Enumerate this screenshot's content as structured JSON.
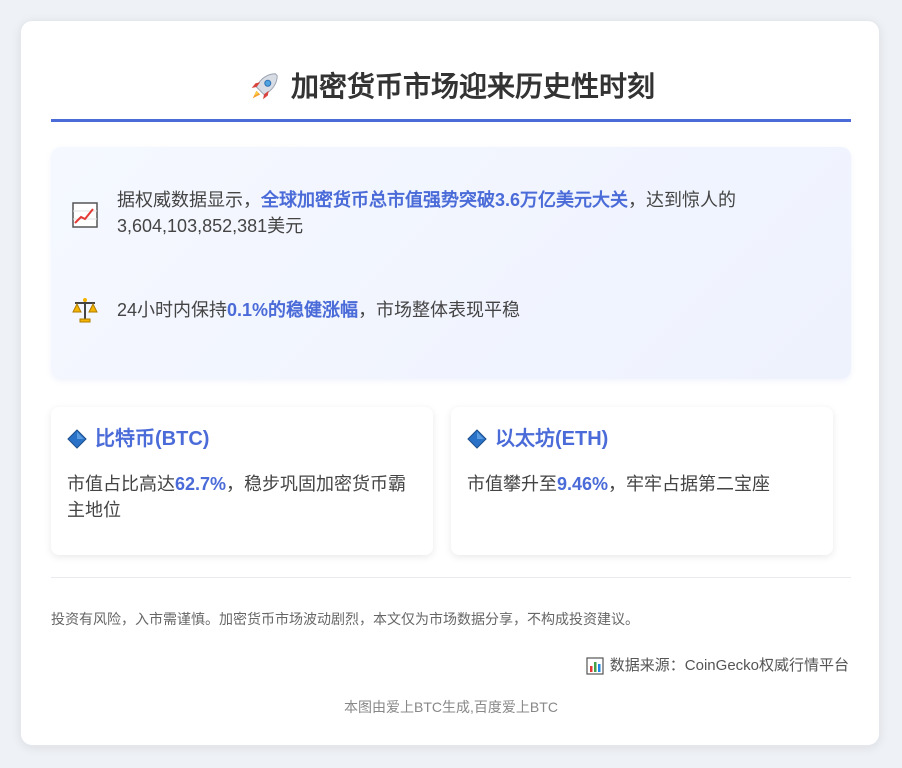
{
  "header": {
    "icon": "rocket-icon",
    "title": "加密货币市场迎来历史性时刻"
  },
  "highlights": [
    {
      "icon": "chart-increasing-icon",
      "text_before": "据权威数据显示，",
      "text_bold": "全球加密货币总市值强势突破3.6万亿美元大关",
      "text_after": "，达到惊人的3,604,103,852,381美元"
    },
    {
      "icon": "balance-scale-icon",
      "text_before": "24小时内保持",
      "text_bold": "0.1%的稳健涨幅",
      "text_after": "，市场整体表现平稳"
    }
  ],
  "coins": [
    {
      "icon": "blue-diamond-icon",
      "title": "比特币(BTC)",
      "desc_before": "市值占比高达",
      "desc_bold": "62.7%",
      "desc_after": "，稳步巩固加密货币霸主地位"
    },
    {
      "icon": "blue-diamond-icon",
      "title": "以太坊(ETH)",
      "desc_before": "市值攀升至",
      "desc_bold": "9.46%",
      "desc_after": "，牢牢占据第二宝座"
    }
  ],
  "disclaimer": "投资有风险，入市需谨慎。加密货币市场波动剧烈，本文仅为市场数据分享，不构成投资建议。",
  "source": {
    "icon": "bar-chart-icon",
    "text": "数据来源：CoinGecko权威行情平台"
  },
  "footer_note": "本图由爱上BTC生成,百度爱上BTC",
  "colors": {
    "accent": "#4a6bd8",
    "background": "#eef1f5",
    "card": "#ffffff",
    "highlight_bg": "#f2f5fe",
    "text": "#333333",
    "muted": "#888888"
  }
}
